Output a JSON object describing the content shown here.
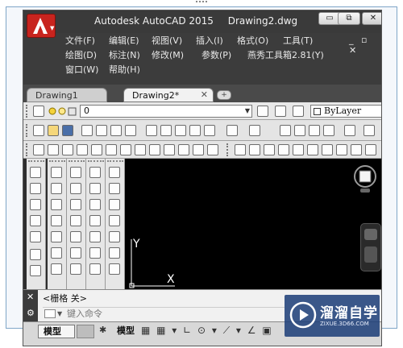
{
  "title_bar": {
    "app_name": "Autodesk AutoCAD 2015",
    "document_name": "Drawing2.dwg",
    "minimize_label": "▭",
    "restore_label": "⧉",
    "close_label": "✕"
  },
  "menu": {
    "row1": [
      "文件(F)",
      "编辑(E)",
      "视图(V)",
      "插入(I)",
      "格式(O)",
      "工具(T)"
    ],
    "row2": [
      "绘图(D)",
      "标注(N)",
      "修改(M)",
      "参数(P)",
      "燕秀工具箱2.81(Y)"
    ],
    "row3": [
      "窗口(W)",
      "帮助(H)"
    ],
    "doc_controls": "_ ▫ ✕"
  },
  "tabs": [
    {
      "label": "Drawing1",
      "active": false
    },
    {
      "label": "Drawing2*",
      "active": true,
      "close": "✕"
    }
  ],
  "tab_add_label": "+",
  "layer_toolbar": {
    "current_layer": "0",
    "color_value": "ByLayer"
  },
  "command": {
    "history": "<栅格 关>",
    "placeholder": "键入命令",
    "close_label": "✕",
    "wrench_label": "🔧"
  },
  "status_bar": {
    "model_tab": "模型",
    "model_label": "模型",
    "star": "✱",
    "icons": "▦ ▦ ▾ ∟ ⊙ ▾ ⟋ ▾ ∠ ▣"
  },
  "canvas": {
    "ucs_x": "X",
    "ucs_y": "Y"
  },
  "watermark": {
    "name": "溜溜自学",
    "url": "ZIXUE.3D66.COM"
  },
  "colors": {
    "app_red": "#c8241e",
    "title_bg": "#3a3a3a",
    "canvas_bg": "#000000",
    "watermark_blue": "#1c3e78"
  }
}
